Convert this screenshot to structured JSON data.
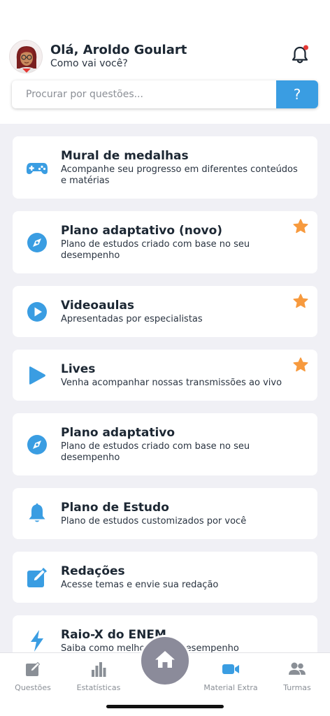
{
  "header": {
    "greeting": "Olá, Aroldo Goulart",
    "subgreeting": "Como vai você?",
    "notification_icon": "bell-icon",
    "notification_dot_color": "#e53935"
  },
  "search": {
    "placeholder": "Procurar por questões...",
    "help_label": "?"
  },
  "colors": {
    "accent": "#3a9de2",
    "star": "#f79a3e",
    "background": "#f0f0f5"
  },
  "cards": [
    {
      "icon": "gamepad-icon",
      "title": "Mural de medalhas",
      "description": "Acompanhe seu progresso em diferentes conteúdos e matérias",
      "starred": false
    },
    {
      "icon": "compass-icon",
      "title": "Plano adaptativo (novo)",
      "description": "Plano de estudos criado com base no seu desempenho",
      "starred": true
    },
    {
      "icon": "play-circle-icon",
      "title": "Videoaulas",
      "description": "Apresentadas por especialistas",
      "starred": true
    },
    {
      "icon": "play-icon",
      "title": "Lives",
      "description": "Venha acompanhar nossas transmissões ao vivo",
      "starred": true
    },
    {
      "icon": "compass-icon",
      "title": "Plano adaptativo",
      "description": "Plano de estudos criado com base no seu desempenho",
      "starred": false
    },
    {
      "icon": "bell-icon",
      "title": "Plano de Estudo",
      "description": "Plano de estudos customizados por você",
      "starred": false
    },
    {
      "icon": "edit-icon",
      "title": "Redações",
      "description": "Acesse temas e envie sua redação",
      "starred": false
    },
    {
      "icon": "lightning-icon",
      "title": "Raio-X do ENEM",
      "description": "Saiba como melhorar seu desempenho",
      "starred": false
    }
  ],
  "tabs": [
    {
      "label": "Questões",
      "icon": "pencil-square-icon",
      "active": false
    },
    {
      "label": "Estatísticas",
      "icon": "bar-chart-icon",
      "active": false
    },
    {
      "label": "",
      "icon": "home-icon",
      "active": false
    },
    {
      "label": "Material Extra",
      "icon": "video-camera-icon",
      "active": true
    },
    {
      "label": "Turmas",
      "icon": "people-icon",
      "active": false
    }
  ]
}
